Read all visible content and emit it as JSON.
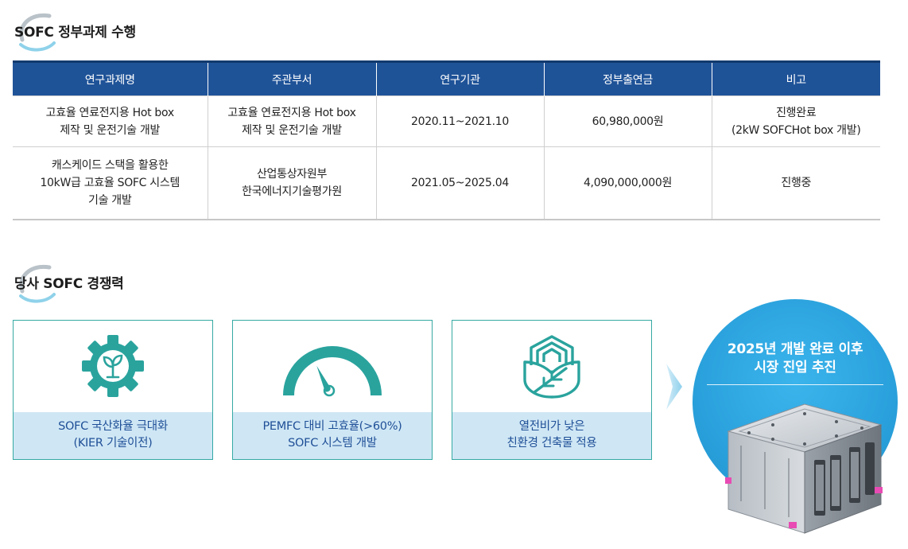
{
  "section1": {
    "title": "SOFC 정부과제 수행"
  },
  "table": {
    "headers": [
      "연구과제명",
      "주관부서",
      "연구기관",
      "정부출연금",
      "비고"
    ],
    "rows": [
      {
        "project": [
          "고효율 연료전지용 Hot box",
          "제작 및 운전기술 개발"
        ],
        "dept": [
          "고효율 연료전지용 Hot box",
          "제작 및 운전기술 개발"
        ],
        "period": "2020.11~2021.10",
        "fund": "60,980,000원",
        "note": [
          "진행완료",
          "(2kW SOFCHot box 개발)"
        ]
      },
      {
        "project": [
          "캐스케이드 스택을 활용한",
          "10kW급 고효율 SOFC 시스템",
          "기술 개발"
        ],
        "dept": [
          "산업통상자원부",
          "한국에너지기술평가원"
        ],
        "period": "2021.05~2025.04",
        "fund": "4,090,000,000원",
        "note": [
          "진행중"
        ]
      }
    ]
  },
  "section2": {
    "title": "당사 SOFC 경쟁력"
  },
  "cards": [
    {
      "icon": "gear-plant-icon",
      "lines": [
        "SOFC 국산화율 극대화",
        "(KIER 기술이전)"
      ]
    },
    {
      "icon": "gauge-icon",
      "lines": [
        "PEMFC 대비 고효율(>60%)",
        "SOFC 시스템 개발"
      ]
    },
    {
      "icon": "eco-building-icon",
      "lines": [
        "열전비가 낮은",
        "친환경 건축물 적용"
      ]
    }
  ],
  "highlight": {
    "lines": [
      "2025년 개발 완료 이후",
      "시장 진입 추진"
    ]
  },
  "colors": {
    "header_blue": "#1f5398",
    "teal": "#2aa39d",
    "label_bg": "#cfe7f5",
    "label_text": "#1f4f97",
    "circle_blue": "#2aa1dc"
  }
}
